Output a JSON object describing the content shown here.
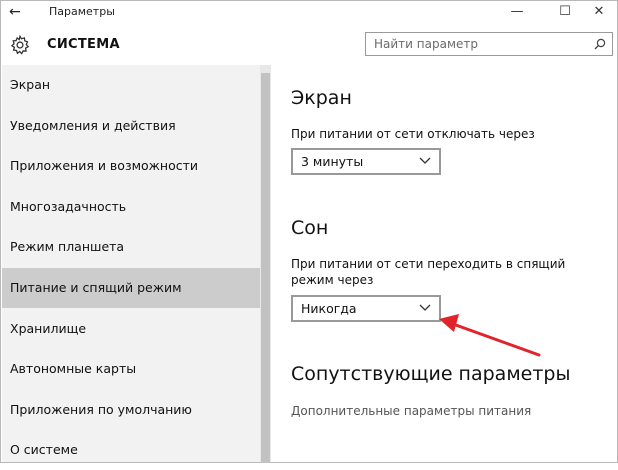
{
  "window": {
    "title": "Параметры",
    "back_icon": "←",
    "minimize_icon": "—",
    "maximize_icon": "☐",
    "close_icon": "✕"
  },
  "header": {
    "title": "СИСТЕМА",
    "search_placeholder": "Найти параметр"
  },
  "sidebar": {
    "items": [
      {
        "label": "Экран"
      },
      {
        "label": "Уведомления и действия"
      },
      {
        "label": "Приложения и возможности"
      },
      {
        "label": "Многозадачность"
      },
      {
        "label": "Режим планшета"
      },
      {
        "label": "Питание и спящий режим",
        "active": true
      },
      {
        "label": "Хранилище"
      },
      {
        "label": "Автономные карты"
      },
      {
        "label": "Приложения по умолчанию"
      },
      {
        "label": "О системе"
      }
    ]
  },
  "main": {
    "screen": {
      "heading": "Экран",
      "label": "При питании от сети отключать через",
      "value": "3 минуты"
    },
    "sleep": {
      "heading": "Сон",
      "label": "При питании от сети переходить в спящий режим через",
      "value": "Никогда"
    },
    "related": {
      "heading": "Сопутствующие параметры",
      "link": "Дополнительные параметры питания"
    }
  },
  "colors": {
    "annotation_arrow": "#e0242b",
    "sidebar_bg": "#f2f2f2",
    "sidebar_active_bg": "#cccccc"
  }
}
